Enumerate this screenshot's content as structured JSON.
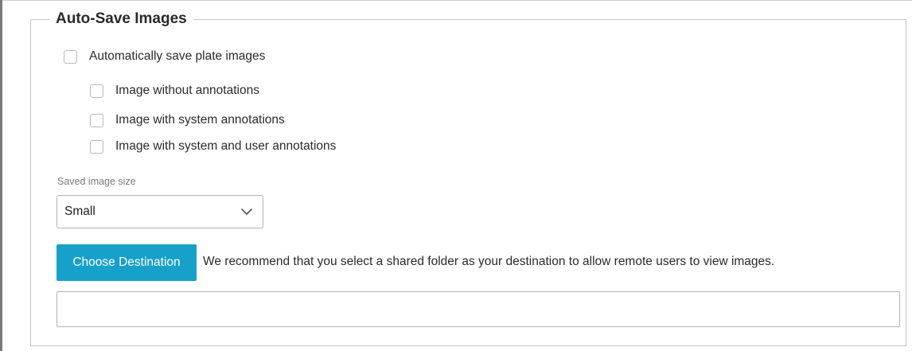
{
  "section": {
    "title": "Auto-Save Images"
  },
  "auto_save": {
    "label": "Automatically save plate images",
    "checked": false
  },
  "image_options": [
    {
      "label": "Image without annotations",
      "checked": false
    },
    {
      "label": "Image with system annotations",
      "checked": false
    },
    {
      "label": "Image with system and user annotations",
      "checked": false
    }
  ],
  "image_size": {
    "label": "Saved image size",
    "value": "Small",
    "icon": "chevron-down-icon"
  },
  "destination": {
    "button_label": "Choose Destination",
    "hint": "We recommend that you select a shared folder as your destination to allow remote users to view images.",
    "path_value": ""
  },
  "colors": {
    "accent": "#17a0c9",
    "border": "#c4c4c4",
    "text": "#2b2b2b",
    "muted_label": "#7a7a7a"
  }
}
